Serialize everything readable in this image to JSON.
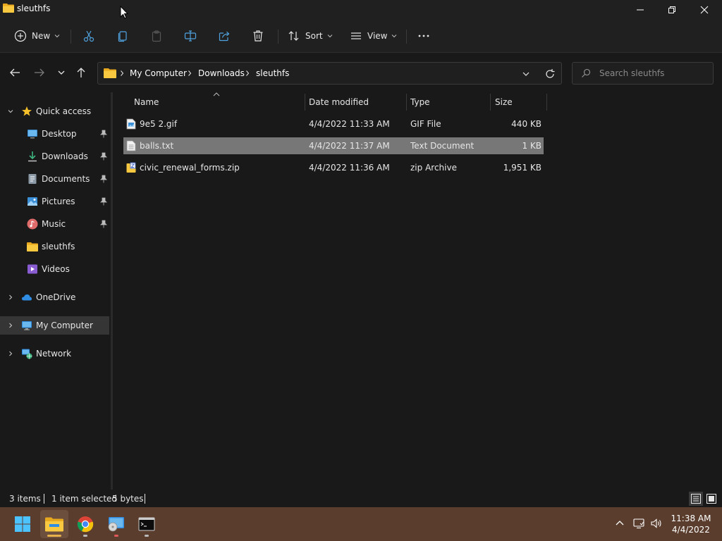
{
  "window": {
    "title": "sleuthfs"
  },
  "commandbar": {
    "new_label": "New",
    "sort_label": "Sort",
    "view_label": "View"
  },
  "address": {
    "crumbs": [
      "My Computer",
      "Downloads",
      "sleuthfs"
    ]
  },
  "search": {
    "placeholder": "Search sleuthfs"
  },
  "sidebar": {
    "items": [
      {
        "label": "Quick access"
      },
      {
        "label": "Desktop"
      },
      {
        "label": "Downloads"
      },
      {
        "label": "Documents"
      },
      {
        "label": "Pictures"
      },
      {
        "label": "Music"
      },
      {
        "label": "sleuthfs"
      },
      {
        "label": "Videos"
      },
      {
        "label": "OneDrive"
      },
      {
        "label": "My Computer"
      },
      {
        "label": "Network"
      }
    ]
  },
  "filelist": {
    "columns": {
      "name": "Name",
      "date": "Date modified",
      "type": "Type",
      "size": "Size"
    },
    "rows": [
      {
        "name": "9e5 2.gif",
        "date": "4/4/2022 11:33 AM",
        "type": "GIF File",
        "size": "440 KB"
      },
      {
        "name": "balls.txt",
        "date": "4/4/2022 11:37 AM",
        "type": "Text Document",
        "size": "1 KB"
      },
      {
        "name": "civic_renewal_forms.zip",
        "date": "4/4/2022 11:36 AM",
        "type": "zip Archive",
        "size": "1,951 KB"
      }
    ]
  },
  "status": {
    "items_count": "3 items",
    "selection": "1 item selected",
    "selection_size": "5 bytes"
  },
  "taskbar": {
    "time": "11:38 AM",
    "date": "4/4/2022"
  },
  "colors": {
    "accent_folder": "#f8c840",
    "selection": "#777777",
    "taskbar": "#5a3d2c"
  }
}
